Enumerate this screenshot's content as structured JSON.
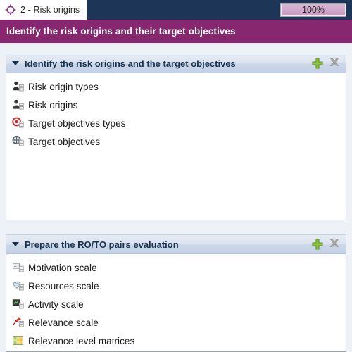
{
  "tab": {
    "label": "2 - Risk origins",
    "icon": "crosshair-target-icon"
  },
  "progress": {
    "value_label": "100%",
    "percent": 100,
    "fill_color": "#cfa5c9"
  },
  "banner": {
    "text": "Identify the risk origins and their target objectives",
    "color": "#86276f"
  },
  "sections": [
    {
      "title": "Identify the risk origins and the target objectives",
      "add_icon": "plus-icon",
      "remove_icon": "close-icon",
      "collapse_icon": "chevron-down-icon",
      "items": [
        {
          "label": "Risk origin types",
          "icon": "person-types-icon"
        },
        {
          "label": "Risk origins",
          "icon": "person-icon"
        },
        {
          "label": "Target objectives types",
          "icon": "red-target-types-icon"
        },
        {
          "label": "Target objectives",
          "icon": "globe-target-icon"
        }
      ]
    },
    {
      "title": "Prepare the RO/TO pairs evaluation",
      "add_icon": "plus-icon",
      "remove_icon": "close-icon",
      "collapse_icon": "chevron-down-icon",
      "items": [
        {
          "label": "Motivation scale",
          "icon": "motivation-card-icon"
        },
        {
          "label": "Resources scale",
          "icon": "gem-icon"
        },
        {
          "label": "Activity scale",
          "icon": "monitor-chart-icon"
        },
        {
          "label": "Relevance scale",
          "icon": "pushpin-icon"
        },
        {
          "label": "Relevance level matrices",
          "icon": "grid-matrix-icon"
        }
      ]
    }
  ]
}
